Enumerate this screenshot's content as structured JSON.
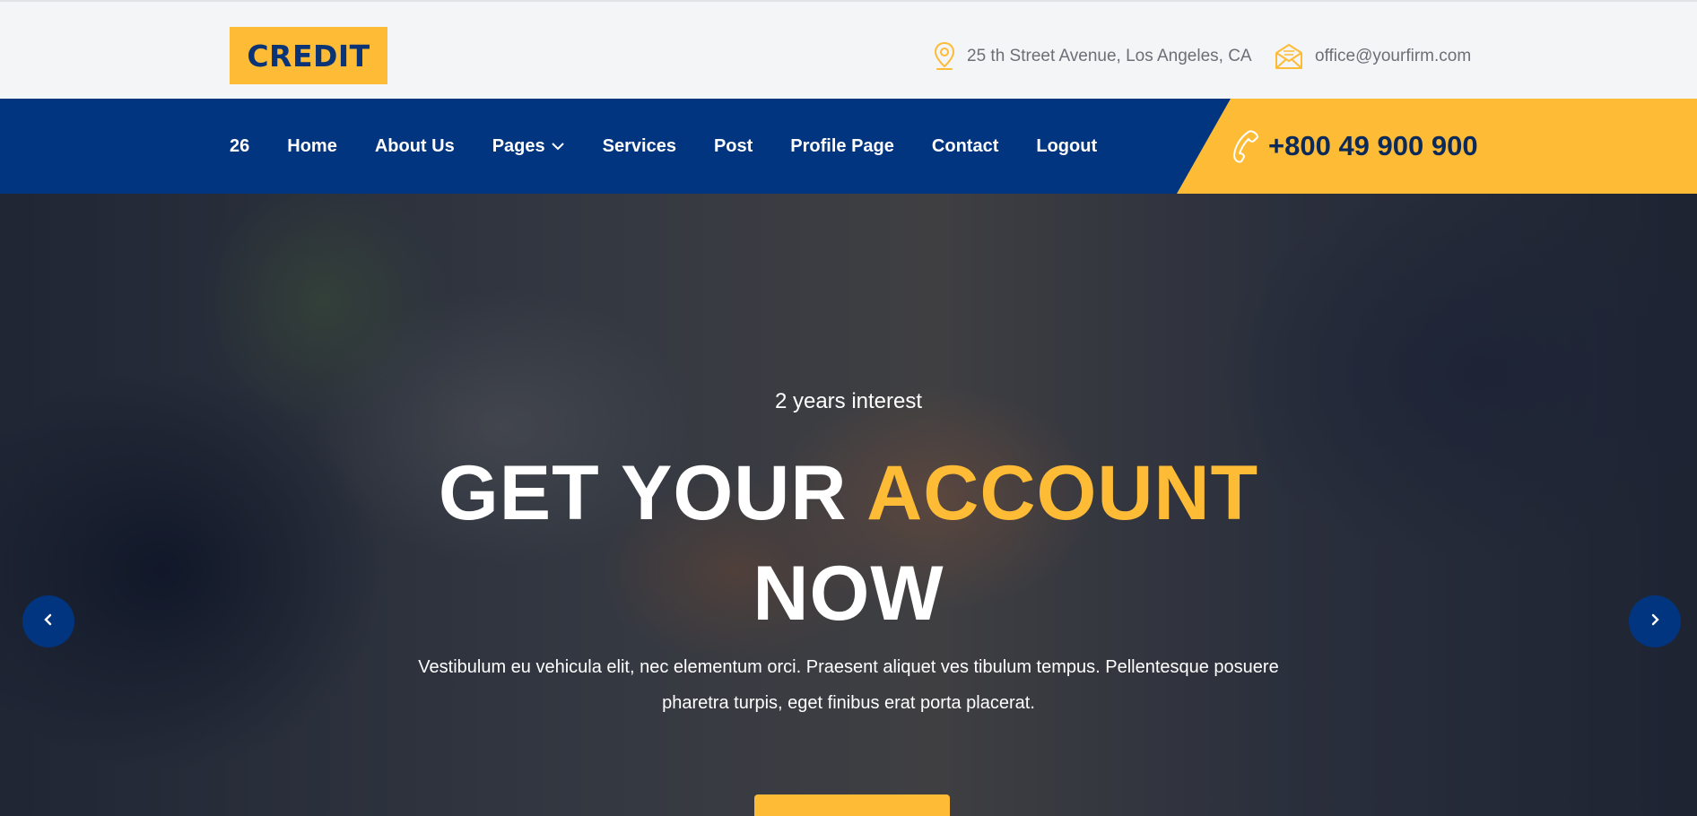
{
  "brand": {
    "logo_text": "CREDIT",
    "accent": "#fdbb36",
    "primary": "#023580"
  },
  "topbar": {
    "address": {
      "icon": "location-pin-icon",
      "text": "25 th Street Avenue, Los Angeles, CA"
    },
    "email": {
      "icon": "envelope-icon",
      "text": "office@yourfirm.com"
    }
  },
  "nav": {
    "items": [
      {
        "label": "26"
      },
      {
        "label": "Home"
      },
      {
        "label": "About Us"
      },
      {
        "label": "Pages",
        "has_dropdown": true
      },
      {
        "label": "Services"
      },
      {
        "label": "Post"
      },
      {
        "label": "Profile Page"
      },
      {
        "label": "Contact"
      },
      {
        "label": "Logout"
      }
    ],
    "phone": {
      "icon": "phone-icon",
      "number": "+800 49 900 900"
    }
  },
  "hero": {
    "subtitle": "2 years interest",
    "headline_white": "GET YOUR",
    "headline_accent": "ACCOUNT",
    "headline_line2": "NOW",
    "description": "Vestibulum eu vehicula elit, nec elementum orci. Praesent aliquet ves tibulum tempus. Pellentesque posuere pharetra turpis, eget finibus erat porta placerat.",
    "prev_icon": "chevron-left-icon",
    "next_icon": "chevron-right-icon"
  }
}
